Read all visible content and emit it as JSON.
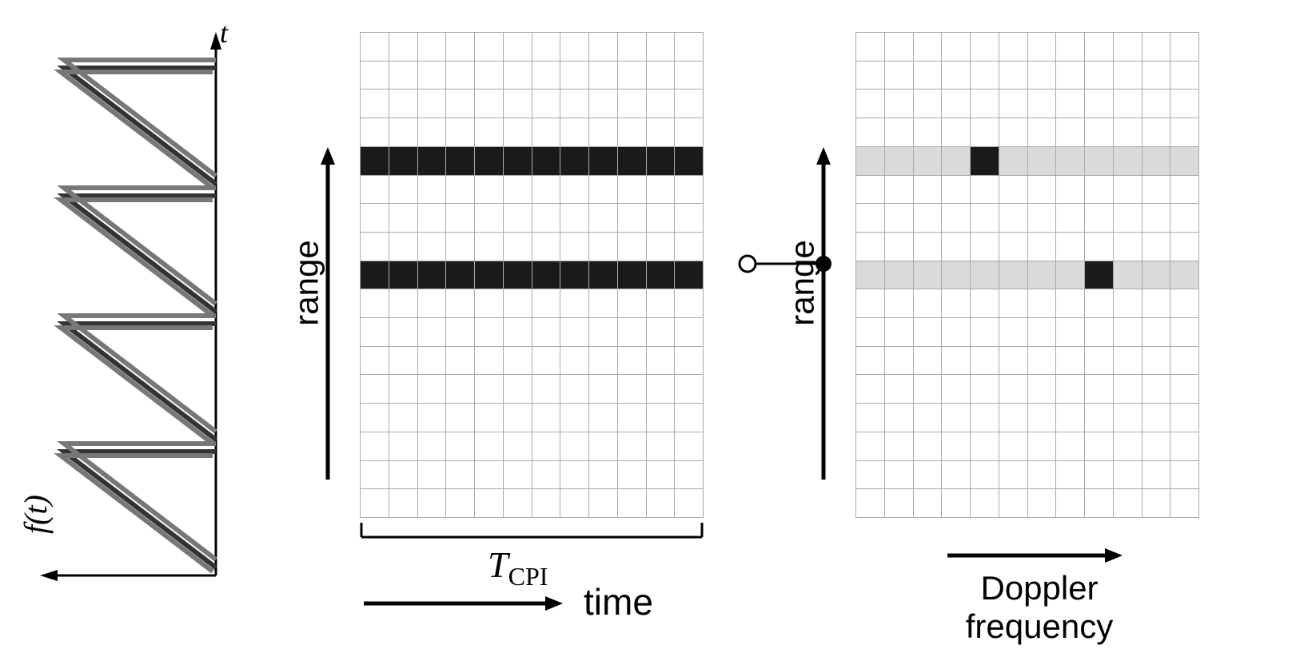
{
  "panel1": {
    "x_label": "f(t)",
    "y_label": "t",
    "description": "Sawtooth frequency-modulated waveform (rotated); two overlapping traces (transmitted and received) over 4 chirp periods"
  },
  "panel2": {
    "y_label": "range",
    "x_label_top": "T_CPI",
    "x_label_bottom": "time",
    "grid_rows": 17,
    "grid_cols": 12,
    "dark_rows": [
      4,
      8
    ],
    "description": "Range-time matrix; two targets occupy full rows (all slow-time columns) at range rows 4 and 8 from top"
  },
  "transform_marker": {
    "description": "Open circle to filled circle indicating transform (FFT along slow time)"
  },
  "panel3": {
    "y_label": "range",
    "x_label": "Doppler frequency",
    "grid_rows": 17,
    "grid_cols": 12,
    "light_rows": [
      4,
      8
    ],
    "dark_cells": [
      [
        4,
        4
      ],
      [
        8,
        8
      ]
    ],
    "description": "Range-Doppler map; light rows at range indices 4 and 8, with single dark peak cells at Doppler columns 4 and 8 respectively"
  },
  "chart_data": {
    "type": "diagram",
    "panels": [
      {
        "x": "f(t)",
        "y": "t",
        "content": "sawtooth chirp sequence"
      },
      {
        "x": "time (T_CPI)",
        "y": "range",
        "content": "range-time data matrix, targets at rows 4,8"
      },
      {
        "x": "Doppler frequency",
        "y": "range",
        "content": "range-Doppler map, peaks at (row4,col4) and (row8,col8)"
      }
    ]
  }
}
